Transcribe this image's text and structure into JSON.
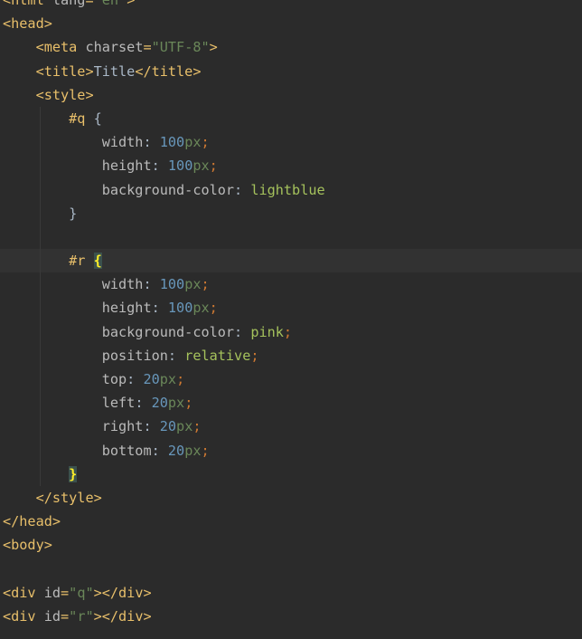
{
  "editor": {
    "lines": [
      {
        "indent": 0,
        "tokens": [
          [
            "tag",
            "<html "
          ],
          [
            "attr",
            "lang"
          ],
          [
            "tag",
            "="
          ],
          [
            "str",
            "\"en\""
          ],
          [
            "tag",
            ">"
          ]
        ]
      },
      {
        "indent": 0,
        "tokens": [
          [
            "tag",
            "<head>"
          ]
        ]
      },
      {
        "indent": 1,
        "tokens": [
          [
            "tag",
            "<meta "
          ],
          [
            "attr",
            "charset"
          ],
          [
            "tag",
            "="
          ],
          [
            "str",
            "\"UTF-8\""
          ],
          [
            "tag",
            ">"
          ]
        ]
      },
      {
        "indent": 1,
        "tokens": [
          [
            "tag",
            "<title>"
          ],
          [
            "txt",
            "Title"
          ],
          [
            "tag",
            "</title>"
          ]
        ]
      },
      {
        "indent": 1,
        "tokens": [
          [
            "tag",
            "<style>"
          ]
        ]
      },
      {
        "indent": 2,
        "tokens": [
          [
            "sel",
            "#q"
          ],
          [
            "txt",
            " "
          ],
          [
            "brace",
            "{"
          ]
        ]
      },
      {
        "indent": 3,
        "tokens": [
          [
            "prop",
            "width"
          ],
          [
            "txt",
            ": "
          ],
          [
            "num",
            "100"
          ],
          [
            "unit",
            "px"
          ],
          [
            "punc",
            ";"
          ]
        ]
      },
      {
        "indent": 3,
        "tokens": [
          [
            "prop",
            "height"
          ],
          [
            "txt",
            ": "
          ],
          [
            "num",
            "100"
          ],
          [
            "unit",
            "px"
          ],
          [
            "punc",
            ";"
          ]
        ]
      },
      {
        "indent": 3,
        "tokens": [
          [
            "prop",
            "background-color"
          ],
          [
            "txt",
            ": "
          ],
          [
            "val",
            "lightblue"
          ]
        ]
      },
      {
        "indent": 2,
        "tokens": [
          [
            "brace",
            "}"
          ]
        ]
      },
      {
        "indent": 0,
        "tokens": []
      },
      {
        "indent": 2,
        "current": true,
        "tokens": [
          [
            "sel",
            "#r"
          ],
          [
            "txt",
            " "
          ],
          [
            "brace-match",
            "{"
          ]
        ]
      },
      {
        "indent": 3,
        "tokens": [
          [
            "prop",
            "width"
          ],
          [
            "txt",
            ": "
          ],
          [
            "num",
            "100"
          ],
          [
            "unit",
            "px"
          ],
          [
            "punc",
            ";"
          ]
        ]
      },
      {
        "indent": 3,
        "tokens": [
          [
            "prop",
            "height"
          ],
          [
            "txt",
            ": "
          ],
          [
            "num",
            "100"
          ],
          [
            "unit",
            "px"
          ],
          [
            "punc",
            ";"
          ]
        ]
      },
      {
        "indent": 3,
        "tokens": [
          [
            "prop",
            "background-color"
          ],
          [
            "txt",
            ": "
          ],
          [
            "val",
            "pink"
          ],
          [
            "punc",
            ";"
          ]
        ]
      },
      {
        "indent": 3,
        "tokens": [
          [
            "prop",
            "position"
          ],
          [
            "txt",
            ": "
          ],
          [
            "val",
            "relative"
          ],
          [
            "punc",
            ";"
          ]
        ]
      },
      {
        "indent": 3,
        "tokens": [
          [
            "prop",
            "top"
          ],
          [
            "txt",
            ": "
          ],
          [
            "num",
            "20"
          ],
          [
            "unit",
            "px"
          ],
          [
            "punc",
            ";"
          ]
        ]
      },
      {
        "indent": 3,
        "tokens": [
          [
            "prop",
            "left"
          ],
          [
            "txt",
            ": "
          ],
          [
            "num",
            "20"
          ],
          [
            "unit",
            "px"
          ],
          [
            "punc",
            ";"
          ]
        ]
      },
      {
        "indent": 3,
        "tokens": [
          [
            "prop",
            "right"
          ],
          [
            "txt",
            ": "
          ],
          [
            "num",
            "20"
          ],
          [
            "unit",
            "px"
          ],
          [
            "punc",
            ";"
          ]
        ]
      },
      {
        "indent": 3,
        "tokens": [
          [
            "prop",
            "bottom"
          ],
          [
            "txt",
            ": "
          ],
          [
            "num",
            "20"
          ],
          [
            "unit",
            "px"
          ],
          [
            "punc",
            ";"
          ]
        ]
      },
      {
        "indent": 2,
        "tokens": [
          [
            "brace-match",
            "}"
          ]
        ]
      },
      {
        "indent": 1,
        "tokens": [
          [
            "tag",
            "</style>"
          ]
        ]
      },
      {
        "indent": 0,
        "tokens": [
          [
            "tag",
            "</head>"
          ]
        ]
      },
      {
        "indent": 0,
        "tokens": [
          [
            "tag",
            "<body>"
          ]
        ]
      },
      {
        "indent": 0,
        "tokens": []
      },
      {
        "indent": 0,
        "tokens": [
          [
            "tag",
            "<div "
          ],
          [
            "attr",
            "id"
          ],
          [
            "tag",
            "="
          ],
          [
            "str",
            "\"q\""
          ],
          [
            "tag",
            "></div>"
          ]
        ]
      },
      {
        "indent": 0,
        "tokens": [
          [
            "tag",
            "<div "
          ],
          [
            "attr",
            "id"
          ],
          [
            "tag",
            "="
          ],
          [
            "str",
            "\"r\""
          ],
          [
            "tag",
            "></div>"
          ]
        ]
      }
    ]
  }
}
